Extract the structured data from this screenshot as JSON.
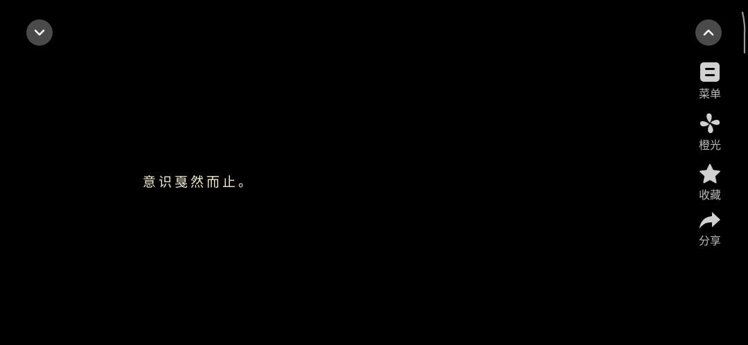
{
  "story": {
    "text": "意识戛然而止。"
  },
  "sidebar": {
    "menu_label": "菜单",
    "light_label": "橙光",
    "favorite_label": "收藏",
    "share_label": "分享"
  },
  "icons": {
    "collapse": "chevron-down-icon",
    "expand": "chevron-up-icon",
    "menu": "menu-note-icon",
    "light": "orange-light-flower-icon",
    "favorite": "star-icon",
    "share": "share-arrow-icon"
  },
  "colors": {
    "background": "#000000",
    "text": "#efe8cf",
    "icon": "#d0d0d0",
    "button_bg": "#4a4a4a"
  }
}
